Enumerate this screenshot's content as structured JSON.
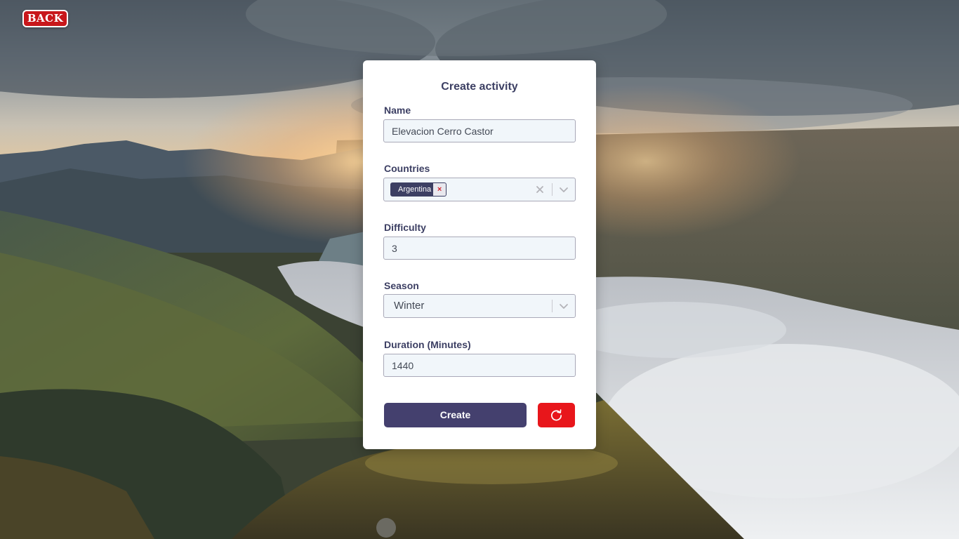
{
  "nav": {
    "back_label": "BACK"
  },
  "form": {
    "title": "Create activity",
    "name": {
      "label": "Name",
      "value": "Elevacion Cerro Castor"
    },
    "countries": {
      "label": "Countries",
      "selected": [
        "Argentina"
      ],
      "remove_glyph": "×"
    },
    "difficulty": {
      "label": "Difficulty",
      "value": "3"
    },
    "season": {
      "label": "Season",
      "value": "Winter"
    },
    "duration": {
      "label": "Duration (Minutes)",
      "value": "1440"
    },
    "create_label": "Create",
    "reset_icon": "refresh-icon"
  },
  "colors": {
    "accent": "#44406e",
    "danger": "#e8161b",
    "back_button": "#c8171b",
    "input_background": "#f1f6fa",
    "label_text": "#3c3f63"
  }
}
